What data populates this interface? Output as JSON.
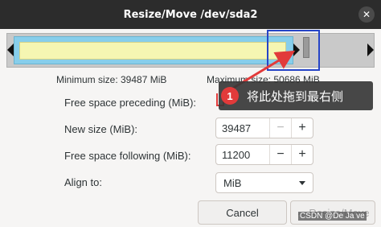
{
  "window": {
    "title": "Resize/Move /dev/sda2",
    "close_glyph": "✕"
  },
  "partition": {
    "min_size_label": "Minimum size: 39487 MiB",
    "max_size_label": "Maximum size: 50686 MiB"
  },
  "fields": {
    "free_preceding": {
      "label": "Free space preceding (MiB):",
      "value": ""
    },
    "new_size": {
      "label": "New size (MiB):",
      "value": "39487"
    },
    "free_following": {
      "label": "Free space following (MiB):",
      "value": "11200"
    },
    "align": {
      "label": "Align to:",
      "value": "MiB"
    }
  },
  "stepper": {
    "minus": "−",
    "plus": "+"
  },
  "buttons": {
    "cancel": "Cancel",
    "resize_move": "Resize/Move",
    "resize_icon": "↔"
  },
  "annotation": {
    "number": "1",
    "text": "将此处拖到最右侧",
    "color": "#e23a3a",
    "box_color": "#2645c7"
  },
  "watermark": "CSDN @De Ja ve"
}
